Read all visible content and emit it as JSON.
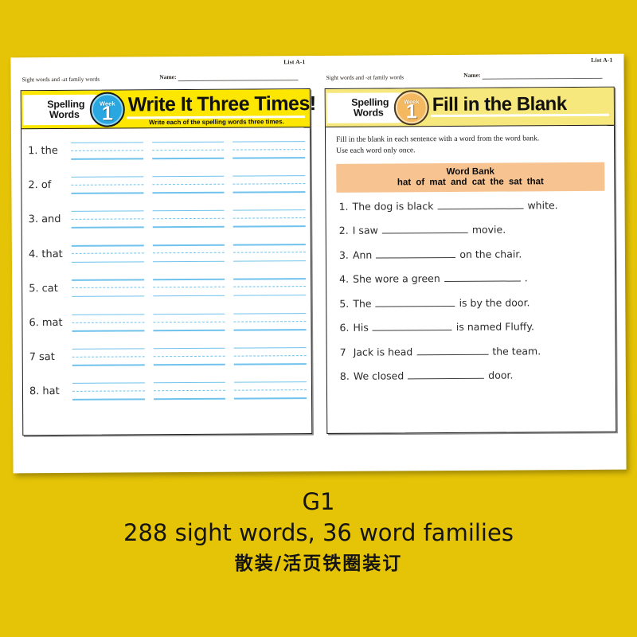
{
  "background_color": "#E5C307",
  "pages": [
    {
      "list_number": "List A-1",
      "topic_line": "Sight words and -at family words",
      "name_label": "Name:",
      "banner": {
        "spelling_line1": "Spelling",
        "spelling_line2": "Words",
        "week_label": "Week",
        "week_number": "1",
        "title": "Write It Three Times!",
        "subtitle": "Write each of the spelling words three times.",
        "banner_color": "#FDE600",
        "badge_color": "#2AA7E0"
      },
      "words": [
        {
          "num": "1.",
          "word": "the"
        },
        {
          "num": "2.",
          "word": "of"
        },
        {
          "num": "3.",
          "word": "and"
        },
        {
          "num": "4.",
          "word": "that"
        },
        {
          "num": "5.",
          "word": "cat"
        },
        {
          "num": "6.",
          "word": "mat"
        },
        {
          "num": "7",
          "word": "sat"
        },
        {
          "num": "8.",
          "word": "hat"
        }
      ]
    },
    {
      "list_number": "List A-1",
      "topic_line": "Sight words and -at family words",
      "name_label": "Name:",
      "banner": {
        "spelling_line1": "Spelling",
        "spelling_line2": "Words",
        "week_label": "Week",
        "week_number": "1",
        "title": "Fill in the Blank",
        "subtitle": "",
        "banner_color": "#F7E87E",
        "badge_color": "#F4B860"
      },
      "instructions_line1": "Fill in the blank in each sentence with a word from the word bank.",
      "instructions_line2": "Use each word only once.",
      "word_bank": {
        "title": "Word Bank",
        "words": "hat  of  mat  and  cat  the  sat  that",
        "color": "#F7C390"
      },
      "sentences": [
        {
          "num": "1.",
          "before": "The dog is black",
          "blank_width": 108,
          "after": "white."
        },
        {
          "num": "2.",
          "before": "I saw",
          "blank_width": 108,
          "after": "movie."
        },
        {
          "num": "3.",
          "before": "Ann",
          "blank_width": 100,
          "after": "on the chair."
        },
        {
          "num": "4.",
          "before": "She wore a green",
          "blank_width": 96,
          "after": "."
        },
        {
          "num": "5.",
          "before": "The",
          "blank_width": 100,
          "after": "is by the door."
        },
        {
          "num": "6.",
          "before": "His",
          "blank_width": 100,
          "after": "is named Fluffy."
        },
        {
          "num": "7",
          "before": "Jack is head",
          "blank_width": 90,
          "after": "the team."
        },
        {
          "num": "8.",
          "before": "We closed",
          "blank_width": 96,
          "after": "door."
        }
      ]
    }
  ],
  "caption": {
    "grade": "G1",
    "summary": "288 sight words,  36 word families",
    "chinese": "散装/活页铁圈装订"
  }
}
